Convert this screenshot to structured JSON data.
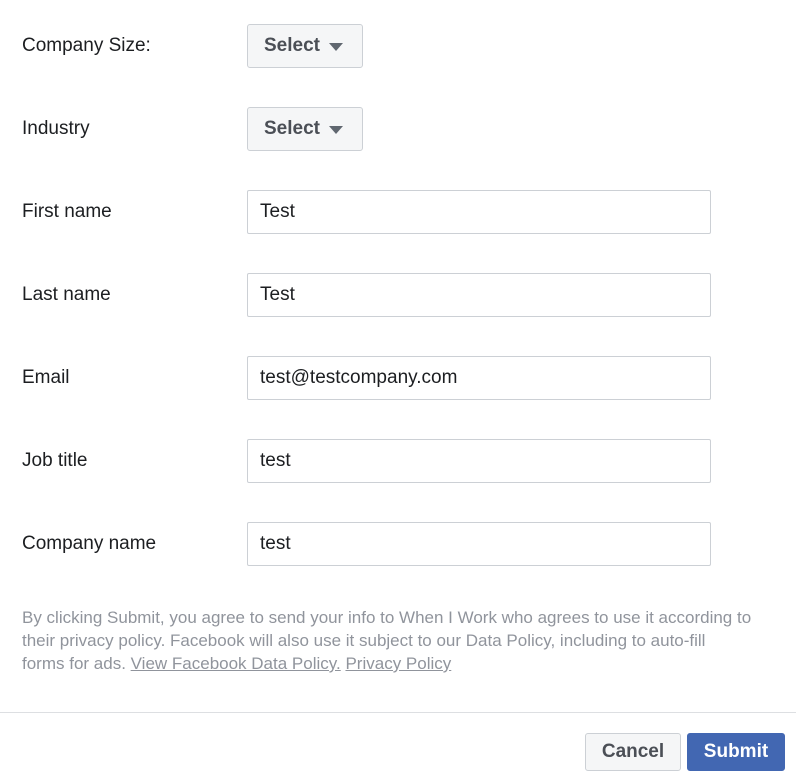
{
  "form": {
    "company_size": {
      "label": "Company Size:",
      "value": "Select"
    },
    "industry": {
      "label": "Industry",
      "value": "Select"
    },
    "first_name": {
      "label": "First name",
      "value": "Test"
    },
    "last_name": {
      "label": "Last name",
      "value": "Test"
    },
    "email": {
      "label": "Email",
      "value": "test@testcompany.com"
    },
    "job_title": {
      "label": "Job title",
      "value": "test"
    },
    "company_name": {
      "label": "Company name",
      "value": "test"
    }
  },
  "disclaimer": {
    "text": "By clicking Submit, you agree to send your info to When I Work who agrees to use it according to their privacy policy. Facebook will also use it subject to our Data Policy, including to auto-fill forms for ads. ",
    "data_policy_link": "View Facebook Data Policy.",
    "privacy_policy_link": "Privacy Policy"
  },
  "footer": {
    "cancel_label": "Cancel",
    "submit_label": "Submit"
  },
  "colors": {
    "submit_bg": "#4267b2",
    "text": "#1c1e21",
    "muted_text": "#90949c",
    "border": "#ccd0d5"
  },
  "icons": {
    "dropdown": "caret-down-icon"
  }
}
